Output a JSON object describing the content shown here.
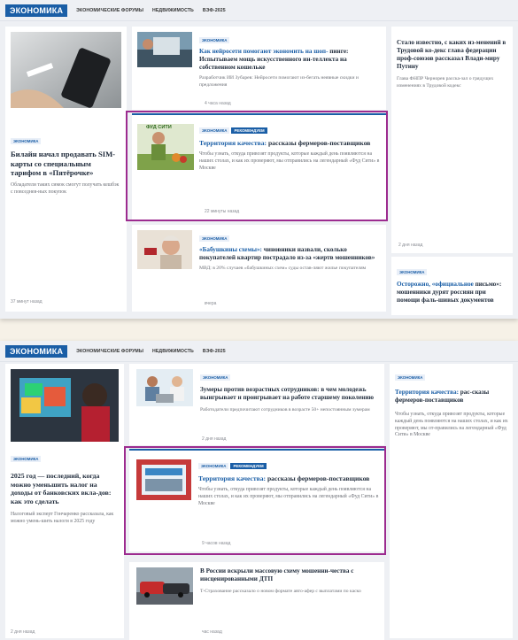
{
  "nav": {
    "rubric": "ЭКОНОМИКА",
    "links": [
      "ЭКОНОМИЧЕСКИЕ ФОРУМЫ",
      "НЕДВИЖИМОСТЬ",
      "ВЭФ-2025"
    ]
  },
  "tag_economy": "ЭКОНОМИКА",
  "tag_recommend": "РЕКОМЕНДУЕМ",
  "logo_text": "ФУД СИТИ",
  "shot1": {
    "left_card": {
      "title": "Билайн начал продавать SIM-карты со специальным тарифом в «Пятёрочке»",
      "lead": "Обладатели таких симок смогут получать кешбэк с повседнев-ных покупок",
      "time": "37 минут назад"
    },
    "mid_top": {
      "title_hl": "Как нейросети помогают экономить на шоп-",
      "title_rest": "пинге: Испытываем мощь искусственного ин-теллекта на собственном кошельке",
      "lead": "Разработчик ИИ Зубарев: Нейросети помогают из-бегать неявные скидки и предложения",
      "time": "4 часа назад"
    },
    "mid_feature": {
      "title_hl": "Территория качества:",
      "title_rest": "рассказы фермеров-поставщиков",
      "lead": "Чтобы узнать, откуда привозят продукты, которые каждый день появляются на наших столах, и как их проверяют, мы отправились на легендарный «Фуд Сити» в Москве",
      "time": "22 минуты назад"
    },
    "mid_bottom": {
      "title_hl": "«Бабушкины схемы»:",
      "title_rest": "чиновники назвали, сколько покупателей квартир пострадало из-за «жертв мошенников»",
      "lead": "МВД: в 20% случаев «бабушкиных схем» суды остав-ляют жилье покупателям",
      "time": "вчера"
    },
    "right_top": {
      "title": "Стало известно, с каких из-менений в Трудовой ко-декс глава федерации проф-союзов рассказал Влади-миру Путину",
      "lead": "Глава ФНПР Чернорев расска-зал о грядущих изменениях в Трудовой кодекс",
      "time": "2 дня назад"
    },
    "right_bottom": {
      "title_hl": "Осторожно, «официальное",
      "title_rest": "письмо»: мошенники дурят россиян при помощи фаль-шивых документов"
    }
  },
  "shot2": {
    "left_card": {
      "title": "2025 год — последний, когда можно уменьшить налог на доходы от банковских вкла-дов: как это сделать",
      "lead": "Налоговый эксперт Гончаренко рассказала, как можно умень-шить налоги в 2025 году",
      "time": "2 дня назад"
    },
    "mid_top": {
      "title": "Зумеры против возрастных сотрудников: в чем молодежь выигрывает и проигрывает на работе старшему поколению",
      "lead": "Работодатели предпочитают сотрудников в возрасте 50+ непостоянным зумерам",
      "time": "2 дня назад"
    },
    "mid_feature": {
      "title_hl": "Территория качества:",
      "title_rest": "рассказы фермеров-поставщиков",
      "lead": "Чтобы узнать, откуда привозят продукты, которые каждый день появляются на наших столах, и как их проверяют, мы отправились на легендарный «Фуд Сити» в Москве",
      "time": "9 часов назад"
    },
    "mid_bottom": {
      "title": "В России вскрыли массовую схему мошенни-чества с инсценированными ДТП",
      "lead": "Т-Страхование рассказало о новом формате авто-афер с выплатами по каско",
      "time": "час назад"
    },
    "right_card": {
      "title_hl": "Территория качества:",
      "title_rest": "рас-сказы фермеров-поставщиков",
      "lead": "Чтобы узнать, откуда привозят продукты, которые каждый день появляются на наших столах, и как их проверяют, мы от-правились на легендарный «Фуд Сити» в Москве"
    }
  }
}
